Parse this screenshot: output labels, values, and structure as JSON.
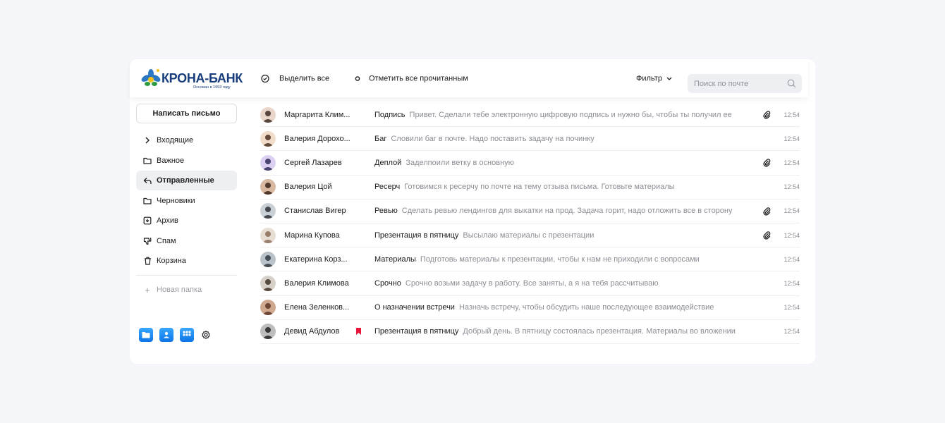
{
  "logo": {
    "name": "КРОНА-БАНК",
    "tagline": "Основан в 1993 году"
  },
  "toolbar": {
    "select_all": "Выделить все",
    "mark_all_read": "Отметить все прочитанным",
    "filter": "Фильтр",
    "search_placeholder": "Поиск по почте"
  },
  "sidebar": {
    "compose": "Написать письмо",
    "folders": [
      {
        "label": "Входящие",
        "icon": "chevron-right-icon"
      },
      {
        "label": "Важное",
        "icon": "folder-icon"
      },
      {
        "label": "Отправленные",
        "icon": "reply-icon",
        "active": true
      },
      {
        "label": "Черновики",
        "icon": "folder-icon"
      },
      {
        "label": "Архив",
        "icon": "archive-icon"
      },
      {
        "label": "Спам",
        "icon": "dislike-icon"
      },
      {
        "label": "Корзина",
        "icon": "trash-icon"
      }
    ],
    "new_folder": "Новая папка",
    "apps": [
      "files-app-icon",
      "contacts-app-icon",
      "calendar-app-icon",
      "gear-icon"
    ]
  },
  "colors": {
    "accent": "#0d74e6",
    "flag": "#e8173a",
    "brand": "#173d7c"
  },
  "emails": [
    {
      "sender": "Маргарита Клим...",
      "subject": "Подпись",
      "preview": "Привет. Сделали тебе электронную цифровую подпись и нужно бы, чтобы ты получил ее",
      "time": "12:54",
      "attachment": true,
      "flag": false
    },
    {
      "sender": "Валерия Дорохо...",
      "subject": "Баг",
      "preview": "Словили баг в почте. Надо поставить задачу на починку",
      "time": "12:54",
      "attachment": false,
      "flag": false
    },
    {
      "sender": "Сергей Лазарев",
      "subject": "Деплой",
      "preview": "Заделпоили ветку в основную",
      "time": "12:54",
      "attachment": true,
      "flag": false
    },
    {
      "sender": "Валерия Цой",
      "subject": "Ресерч",
      "preview": "Готовимся к ресерчу по почте на тему отзыва письма. Готовьте материалы",
      "time": "12:54",
      "attachment": false,
      "flag": false
    },
    {
      "sender": "Станислав Вигер",
      "subject": "Ревью",
      "preview": "Сделать ревью лендингов для выкатки на прод. Задача горит, надо отложить все в сторону",
      "time": "12:54",
      "attachment": true,
      "flag": false
    },
    {
      "sender": "Марина Купова",
      "subject": "Презентация в пятницу",
      "preview": "Высылаю материалы с презентации",
      "time": "12:54",
      "attachment": true,
      "flag": false
    },
    {
      "sender": "Екатерина Корз...",
      "subject": "Материалы",
      "preview": "Подготовь материалы к презентации, чтобы к нам не приходили с вопросами",
      "time": "12:54",
      "attachment": false,
      "flag": false
    },
    {
      "sender": "Валерия Климова",
      "subject": "Срочно",
      "preview": "Срочно возьми задачу в работу. Все заняты, а я на тебя рассчитываю",
      "time": "12:54",
      "attachment": false,
      "flag": false
    },
    {
      "sender": "Елена Зеленков...",
      "subject": "О назначении встречи",
      "preview": "Назначь встречу, чтобы обсудить наше последующее взаимодействие",
      "time": "12:54",
      "attachment": false,
      "flag": false
    },
    {
      "sender": "Девид Абдулов",
      "subject": "Презентация в пятницу",
      "preview": "Добрый день. В пятницу состоялась презентация. Материалы во вложении",
      "time": "12:54",
      "attachment": false,
      "flag": true
    }
  ]
}
